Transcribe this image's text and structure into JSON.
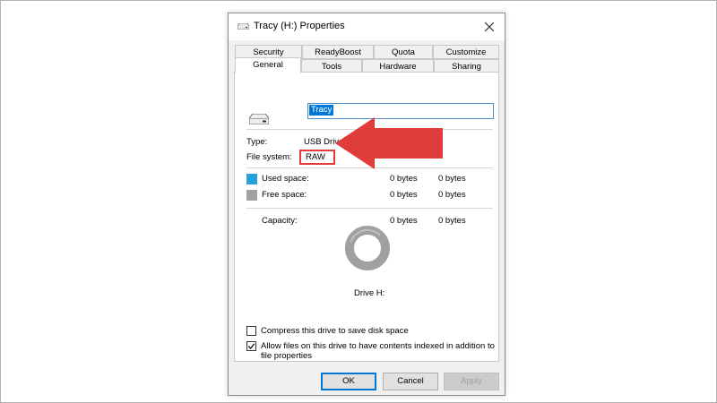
{
  "dialog": {
    "title": "Tracy (H:) Properties",
    "tabs_back": [
      "Security",
      "ReadyBoost",
      "Quota",
      "Customize"
    ],
    "tabs_front": [
      "General",
      "Tools",
      "Hardware",
      "Sharing"
    ],
    "active_tab": "General"
  },
  "general": {
    "drive_name": "Tracy",
    "type_label": "Type:",
    "type_value": "USB Drive",
    "fs_label": "File system:",
    "fs_value": "RAW",
    "used_label": "Used space:",
    "used_bytes": "0 bytes",
    "used_size": "0 bytes",
    "free_label": "Free space:",
    "free_bytes": "0 bytes",
    "free_size": "0 bytes",
    "capacity_label": "Capacity:",
    "capacity_bytes": "0 bytes",
    "capacity_size": "0 bytes",
    "drive_caption": "Drive H:",
    "compress_label": "Compress this drive to save disk space",
    "compress_checked": false,
    "index_label_line1": "Allow files on this drive to have contents indexed in addition to",
    "index_label_line2": "file properties",
    "index_checked": true
  },
  "buttons": {
    "ok": "OK",
    "cancel": "Cancel",
    "apply": "Apply"
  },
  "colors": {
    "used_space": "#26a0da",
    "free_space": "#a0a0a0",
    "annotation": "#e03c3c",
    "selection": "#0078d7"
  },
  "icons": {
    "drive": "usb-drive-icon",
    "close": "close-icon",
    "annotation": "arrow-left-icon"
  }
}
